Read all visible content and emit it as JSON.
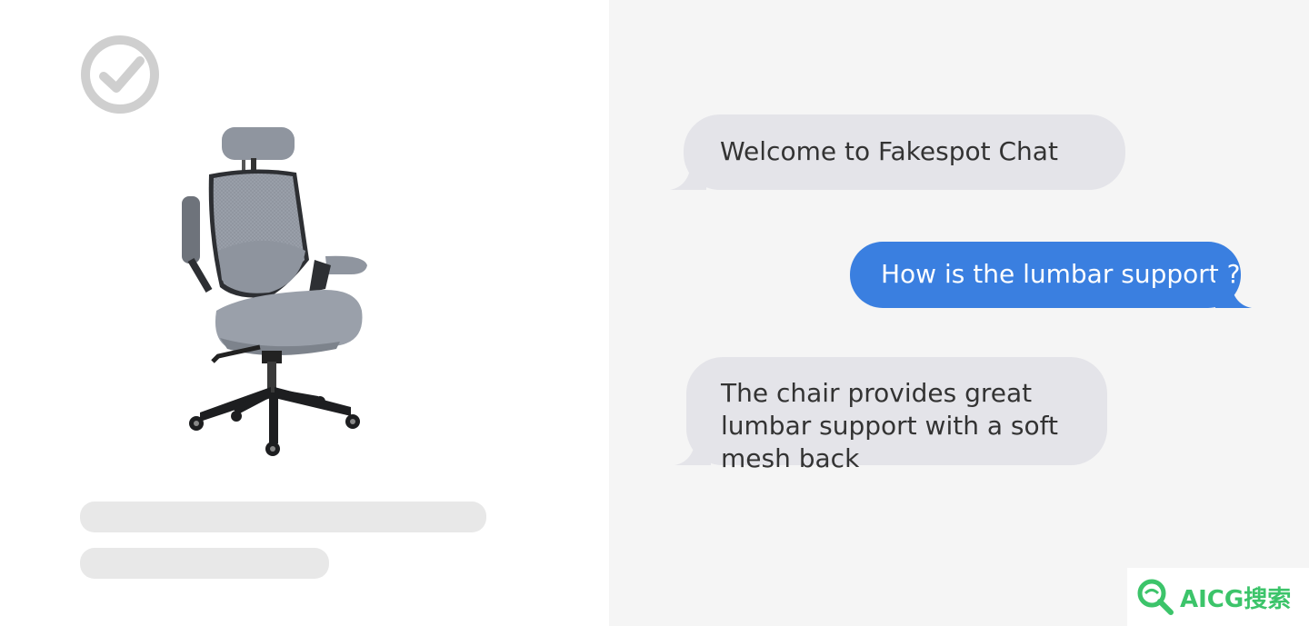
{
  "product": {
    "verified_icon": "check-circle-icon",
    "image": "office-chair-image"
  },
  "chat": {
    "messages": [
      {
        "from": "bot",
        "text": "Welcome to Fakespot Chat"
      },
      {
        "from": "user",
        "text": "How is the lumbar support ?"
      },
      {
        "from": "bot",
        "text": "The chair provides great lumbar support with a soft mesh back"
      }
    ],
    "colors": {
      "bot_bubble": "#e4e4e9",
      "user_bubble": "#3a7fe0",
      "panel_bg": "#f5f5f5"
    }
  },
  "watermark": {
    "text": "AICG搜索",
    "icon": "magnifier-logo-icon",
    "color": "#3cc46a"
  }
}
